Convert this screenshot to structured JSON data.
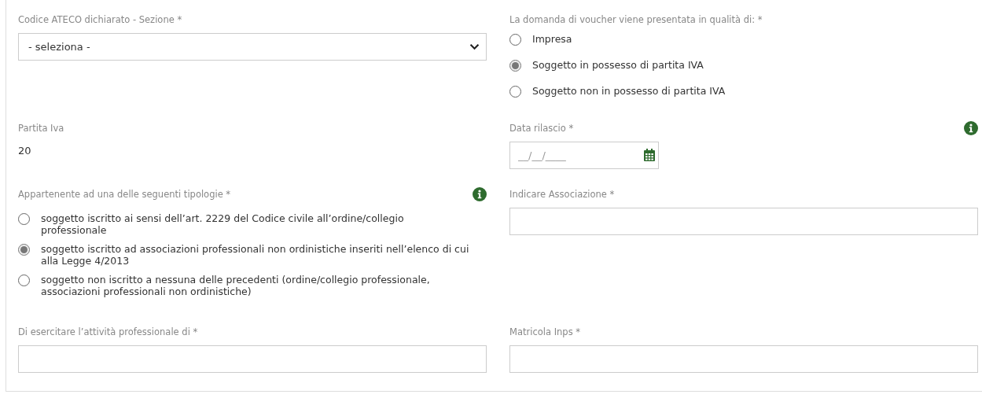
{
  "rows": [
    {
      "left": {
        "kind": "select",
        "label": "Codice ATECO dichiarato - Sezione *",
        "info": false,
        "value": "- seleziona -"
      },
      "right": {
        "kind": "radio",
        "label": "La domanda di voucher viene presentata in qualità di: *",
        "info": false,
        "options": [
          {
            "label": "Impresa",
            "selected": false
          },
          {
            "label": "Soggetto in possesso di partita IVA",
            "selected": true
          },
          {
            "label": "Soggetto non in possesso di partita IVA",
            "selected": false
          }
        ]
      }
    },
    {
      "left": {
        "kind": "text",
        "label": "Partita Iva",
        "info": false,
        "value": "20"
      },
      "right": {
        "kind": "date",
        "label": "Data rilascio *",
        "info": true,
        "placeholder": "__/__/____"
      }
    },
    {
      "left": {
        "kind": "radio",
        "label": "Appartenente ad una delle seguenti tipologie *",
        "info": true,
        "options": [
          {
            "label": "soggetto iscritto ai sensi dell’art. 2229 del Codice civile all’ordine/collegio professionale",
            "selected": false
          },
          {
            "label": "soggetto iscritto ad associazioni professionali non ordinistiche inseriti nell’elenco di cui alla Legge 4/2013",
            "selected": true
          },
          {
            "label": "soggetto non iscritto a nessuna delle precedenti (ordine/collegio professionale, associazioni professionali non ordinistiche)",
            "selected": false
          }
        ]
      },
      "right": {
        "kind": "input",
        "label": "Indicare Associazione *",
        "info": false
      }
    },
    {
      "left": {
        "kind": "input",
        "label": "Di esercitare l’attività professionale di *",
        "info": false
      },
      "right": {
        "kind": "input",
        "label": "Matricola Inps *",
        "info": false
      }
    }
  ]
}
